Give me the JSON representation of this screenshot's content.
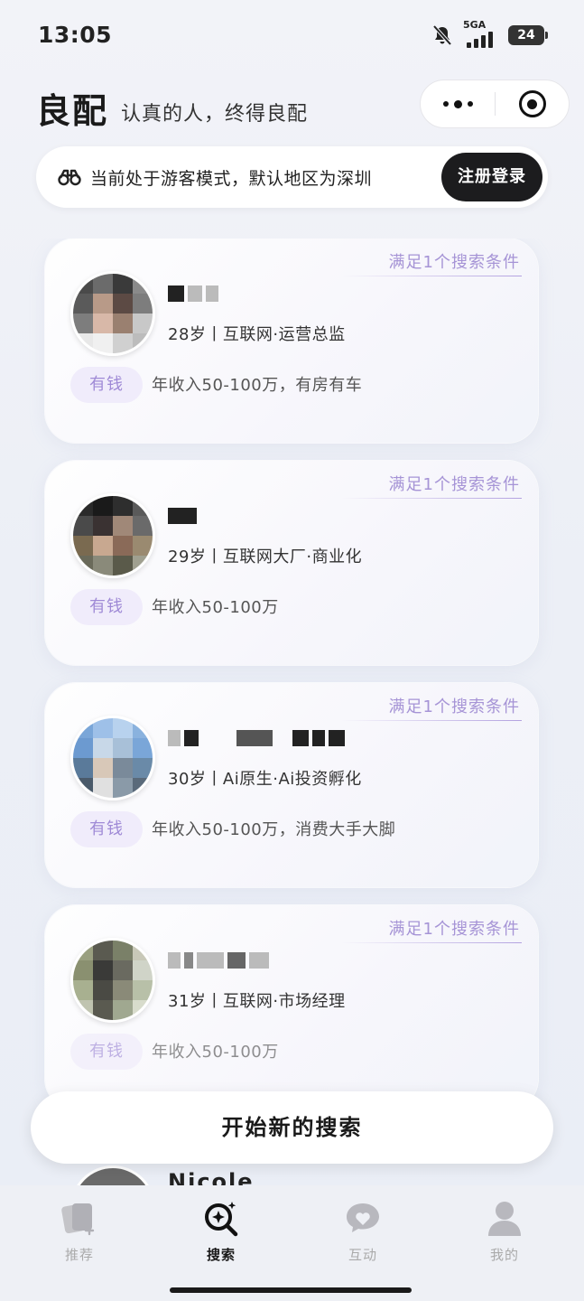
{
  "status_bar": {
    "time": "13:05",
    "network": "5GA",
    "battery": "24",
    "icons": [
      "mute-bell-icon",
      "signal-icon",
      "battery-icon"
    ]
  },
  "header": {
    "title": "良配",
    "slogan": "认真的人，终得良配",
    "capsule_icons": [
      "more-icon",
      "target-icon"
    ]
  },
  "guest_banner": {
    "icon": "binoculars-icon",
    "text": "当前处于游客模式，默认地区为深圳",
    "login_label": "注册登录"
  },
  "cards": [
    {
      "match": "满足1个搜索条件",
      "meta": "28岁丨互联网·运营总监",
      "badge": "有钱",
      "income": "年收入50-100万，有房有车"
    },
    {
      "match": "满足1个搜索条件",
      "meta": "29岁丨互联网大厂·商业化",
      "badge": "有钱",
      "income": "年收入50-100万"
    },
    {
      "match": "满足1个搜索条件",
      "meta": "30岁丨Ai原生·Ai投资孵化",
      "badge": "有钱",
      "income": "年收入50-100万，消费大手大脚"
    },
    {
      "match": "满足1个搜索条件",
      "meta": "31岁丨互联网·市场经理",
      "badge": "有钱",
      "income": "年收入50-100万"
    }
  ],
  "peek_card": {
    "name": "Nicole"
  },
  "new_search_label": "开始新的搜索",
  "tabs": [
    {
      "label": "推荐",
      "icon": "cards-icon",
      "active": false
    },
    {
      "label": "搜索",
      "icon": "search-sparkle-icon",
      "active": true
    },
    {
      "label": "互动",
      "icon": "chat-heart-icon",
      "active": false
    },
    {
      "label": "我的",
      "icon": "user-icon",
      "active": false
    }
  ],
  "colors": {
    "accent_purple": "#a694d6",
    "badge_bg": "#f0ecfb",
    "dark_button": "#1c1c1e"
  }
}
